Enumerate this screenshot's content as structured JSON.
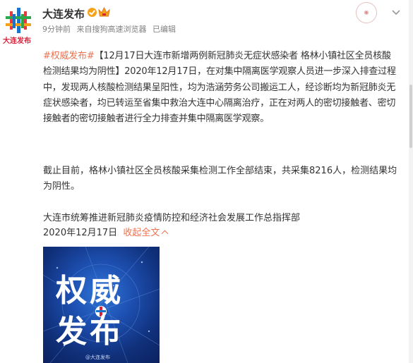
{
  "header": {
    "author": "大连发布",
    "avatar_label": "大连发布",
    "meta": {
      "time": "9分钟前",
      "source_prefix": "来自",
      "source": "搜狗高速浏览器",
      "edited": "已编辑"
    }
  },
  "post": {
    "hashtag": "#权威发布#",
    "paragraph1": "【12月17日大连市新增两例新冠肺炎无症状感染者 格林小镇社区全员核酸检测结果均为阴性】2020年12月17日，在对集中隔离医学观察人员进一步深入排查过程中，发现两人核酸检测结果呈阳性，均为浩涵劳务公司搬运工人，经诊断均为新冠肺炎无症状感染者，均已转运至省集中救治大连中心隔离治疗，正在对两人的密切接触者、密切接触者的密切接触者进行全力排查并集中隔离医学观察。",
    "paragraph2": "截止目前，格林小镇社区全员核酸采集检测工作全部结束，共采集8216人，检测结果均为阴性。",
    "signature": "大连市统筹推进新冠肺炎疫情防控和经济社会发展工作总指挥部",
    "date": "2020年12月17日",
    "collapse_label": "收起全文"
  },
  "image": {
    "line1": "权威",
    "line2": "发布",
    "watermark": "@大连发布"
  },
  "icons": {
    "verified": "verified-badge-icon",
    "vip": "vip-crown-icon",
    "more": "chevron-down-icon"
  },
  "colors": {
    "accent": "#eb7350",
    "brand_red": "#d7243b",
    "verify": "#f7a21b"
  }
}
